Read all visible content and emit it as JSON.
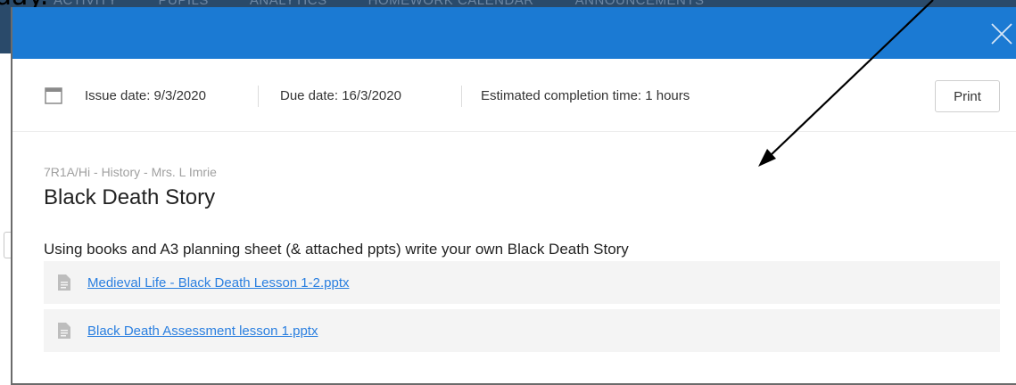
{
  "background": {
    "caption": "day.",
    "nav_items": [
      "ACTIVITY",
      "PUPILS",
      "ANALYTICS",
      "HOMEWORK CALENDAR",
      "ANNOUNCEMENTS"
    ]
  },
  "modal": {
    "header_color": "#1b7ad3",
    "close_icon": "close-icon",
    "meta": {
      "issue_date": "Issue date: 9/3/2020",
      "due_date": "Due date: 16/3/2020",
      "estimated_time": "Estimated completion time: 1 hours",
      "print_label": "Print"
    },
    "class_line": "7R1A/Hi - History - Mrs. L Imrie",
    "title": "Black Death Story",
    "description": "Using books and A3 planning sheet (& attached ppts) write your own Black Death Story",
    "attachments": [
      {
        "name": "Medieval Life - Black Death Lesson 1-2.pptx",
        "icon": "file-icon"
      },
      {
        "name": "Black Death Assessment lesson 1.pptx",
        "icon": "file-icon"
      }
    ]
  },
  "annotation": {
    "type": "arrow",
    "color": "#000000"
  }
}
